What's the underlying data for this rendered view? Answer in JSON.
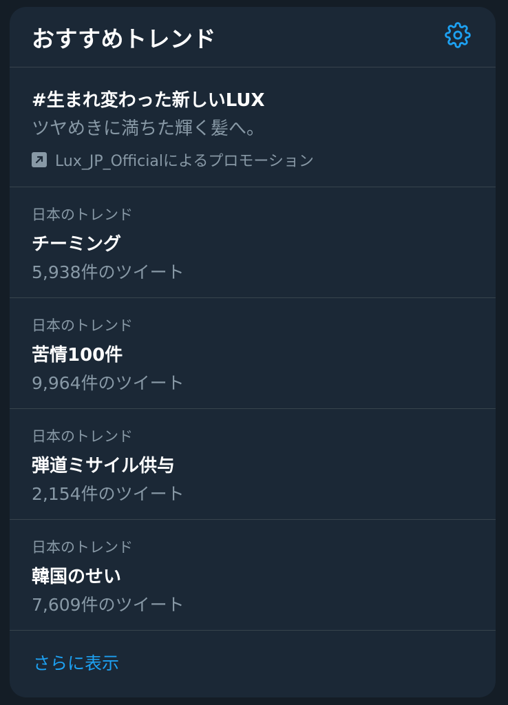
{
  "header": {
    "title": "おすすめトレンド",
    "settings_icon": "gear-icon"
  },
  "promoted": {
    "tag": "#生まれ変わった新しいLUX",
    "description": "ツヤめきに満ちた輝く髪へ。",
    "promoted_by": "Lux_JP_Officialによるプロモーション",
    "icon": "promoted-arrow-icon"
  },
  "trends": [
    {
      "context": "日本のトレンド",
      "name": "チーミング",
      "count": "5,938件のツイート"
    },
    {
      "context": "日本のトレンド",
      "name": "苦情100件",
      "count": "9,964件のツイート"
    },
    {
      "context": "日本のトレンド",
      "name": "弾道ミサイル供与",
      "count": "2,154件のツイート"
    },
    {
      "context": "日本のトレンド",
      "name": "韓国のせい",
      "count": "7,609件のツイート"
    }
  ],
  "footer": {
    "show_more": "さらに表示"
  },
  "colors": {
    "background": "#141d26",
    "panel": "#1b2836",
    "divider": "#38444d",
    "primary_text": "#ffffff",
    "secondary_text": "#8899a6",
    "accent": "#1da1f2"
  }
}
